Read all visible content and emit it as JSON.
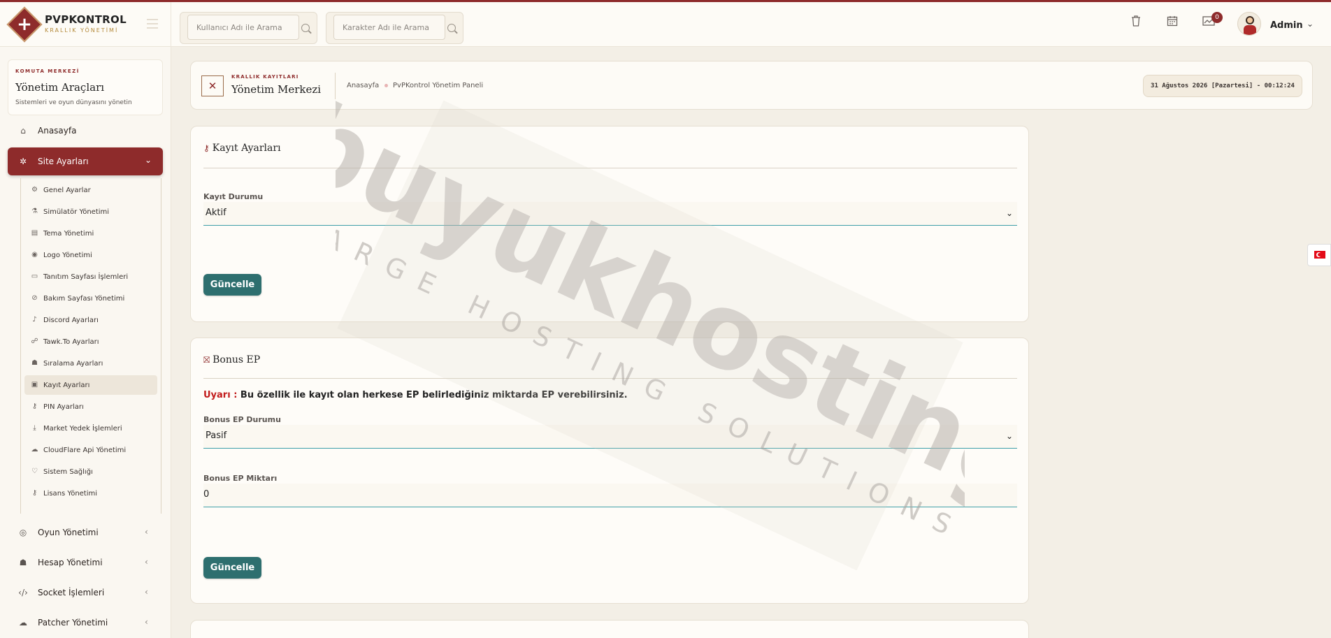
{
  "brand": {
    "name": "PVPKONTROL",
    "subtitle": "KRALLIK YÖNETİMİ"
  },
  "search": {
    "user_placeholder": "Kullanıcı Adı ile Arama",
    "char_placeholder": "Karakter Adı ile Arama"
  },
  "header": {
    "notification_count": "0",
    "user_name": "Admin"
  },
  "sidebar": {
    "kicker": "KOMUTA MERKEZİ",
    "title": "Yönetim Araçları",
    "desc": "Sistemleri ve oyun dünyasını yönetin",
    "items": [
      {
        "label": "Anasayfa",
        "icon": "home-icon"
      },
      {
        "label": "Site Ayarları",
        "icon": "gear-icon"
      },
      {
        "label": "Oyun Yönetimi",
        "icon": "gamepad-icon"
      },
      {
        "label": "Hesap Yönetimi",
        "icon": "users-icon"
      },
      {
        "label": "Socket İşlemleri",
        "icon": "code-icon"
      },
      {
        "label": "Patcher Yönetimi",
        "icon": "cloud-upload-icon"
      }
    ],
    "sub_items": [
      {
        "label": "Genel Ayarlar",
        "icon": "cogs-icon"
      },
      {
        "label": "Simülatör Yönetimi",
        "icon": "flask-icon"
      },
      {
        "label": "Tema Yönetimi",
        "icon": "file-icon"
      },
      {
        "label": "Logo Yönetimi",
        "icon": "eye-icon"
      },
      {
        "label": "Tanıtım Sayfası İşlemleri",
        "icon": "monitor-icon"
      },
      {
        "label": "Bakım Sayfası Yönetimi",
        "icon": "eye-slash-icon"
      },
      {
        "label": "Discord Ayarları",
        "icon": "microphone-icon"
      },
      {
        "label": "Tawk.To Ayarları",
        "icon": "handshake-icon"
      },
      {
        "label": "Sıralama Ayarları",
        "icon": "users-icon"
      },
      {
        "label": "Kayıt Ayarları",
        "icon": "id-card-icon"
      },
      {
        "label": "PIN Ayarları",
        "icon": "key-icon"
      },
      {
        "label": "Market Yedek İşlemleri",
        "icon": "download-icon"
      },
      {
        "label": "CloudFlare Api Yönetimi",
        "icon": "cloud-icon"
      },
      {
        "label": "Sistem Sağlığı",
        "icon": "heartbeat-icon"
      },
      {
        "label": "Lisans Yönetimi",
        "icon": "key-icon"
      }
    ]
  },
  "page": {
    "kicker": "KRALLIK KAYITLARI",
    "title": "Yönetim Merkezi",
    "crumb_home": "Anasayfa",
    "crumb_current": "PvPKontrol Yönetim Paneli",
    "datetime": "31 Ağustos 2026 [Pazartesi] - 00:12:24"
  },
  "kayit_card": {
    "title": "Kayıt Ayarları",
    "status_label": "Kayıt Durumu",
    "status_value": "Aktif",
    "button": "Güncelle"
  },
  "bonus_card": {
    "title": "Bonus EP",
    "warning_prefix": "Uyarı :",
    "warning_text": " Bu özellik ile kayıt olan herkese EP belirlediğiniz miktarda EP verebilirsiniz.",
    "status_label": "Bonus EP Durumu",
    "status_value": "Pasif",
    "amount_label": "Bonus EP Miktarı",
    "amount_value": "0",
    "button": "Güncelle"
  },
  "watermark": {
    "main": "buyukhosting",
    "sub": "LARGE HOSTING SOLUTIONS"
  },
  "colors": {
    "accent": "#8e2b2b",
    "button": "#2e6f6f",
    "field_line": "#3d9ea8"
  }
}
